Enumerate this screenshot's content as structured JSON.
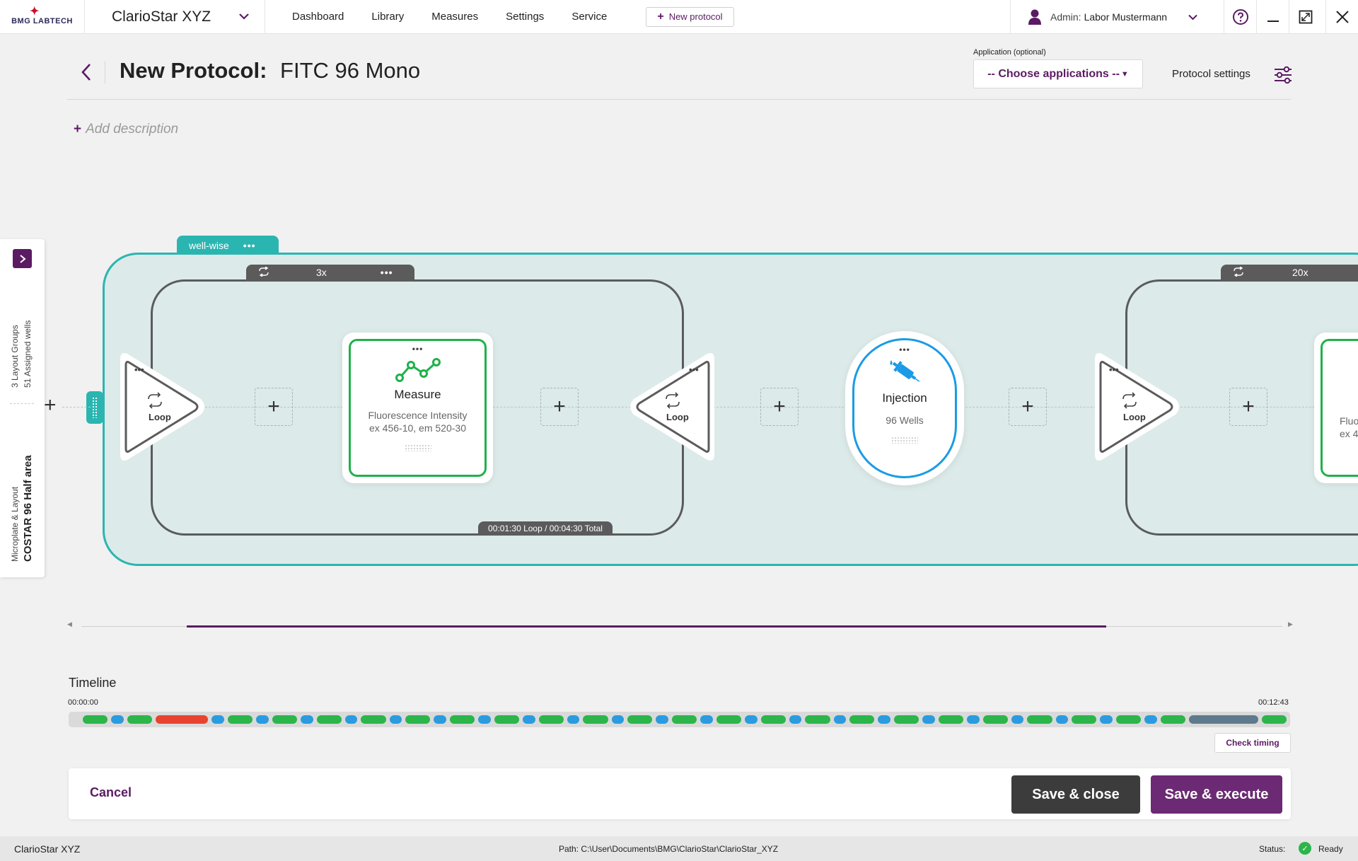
{
  "app": {
    "logo": "BMG LABTECH",
    "device_name": "ClarioStar XYZ"
  },
  "nav": {
    "items": [
      "Dashboard",
      "Library",
      "Measures",
      "Settings",
      "Service"
    ],
    "new_protocol": "New protocol"
  },
  "user": {
    "role": "Admin:",
    "name": "Labor Mustermann"
  },
  "header": {
    "title_prefix": "New Protocol:",
    "title_name": "FITC 96 Mono",
    "application_label": "Application (optional)",
    "application_value": "-- Choose applications --",
    "protocol_settings": "Protocol settings",
    "add_description": "Add description"
  },
  "side_panel": {
    "layout_groups": "3 Layout Groups",
    "assigned_wells": "51 Assigned wells",
    "microplate_label": "Microplate & Layout",
    "microplate_value": "COSTAR 96 Half area"
  },
  "canvas": {
    "well_group_label": "well-wise",
    "loop1": {
      "count": "3x",
      "timing": "00:01:30 Loop / 00:04:30 Total"
    },
    "loop2": {
      "count": "20x"
    },
    "loop_label": "Loop",
    "measure": {
      "title": "Measure",
      "line1": "Fluorescence Intensity",
      "line2": "ex 456-10, em 520-30"
    },
    "injection": {
      "title": "Injection",
      "sub": "96 Wells"
    },
    "partial_node": {
      "line1": "Fluo",
      "line2": "ex 4"
    }
  },
  "timeline": {
    "title": "Timeline",
    "start": "00:00:00",
    "end": "00:12:43",
    "check_timing": "Check timing",
    "colors": {
      "measure": "#2bb54a",
      "injection": "#2b9be0",
      "error": "#e8432f",
      "idle": "#5e7b8c"
    },
    "segments": [
      {
        "t": "measure",
        "w": 36
      },
      {
        "t": "injection",
        "w": 18
      },
      {
        "t": "measure",
        "w": 36
      },
      {
        "t": "error",
        "w": 76
      },
      {
        "t": "injection",
        "w": 18
      },
      {
        "t": "measure",
        "w": 36
      },
      {
        "t": "injection",
        "w": 18
      },
      {
        "t": "measure",
        "w": 36
      },
      {
        "t": "injection",
        "w": 18
      },
      {
        "t": "measure",
        "w": 36
      },
      {
        "t": "injection",
        "w": 18
      },
      {
        "t": "measure",
        "w": 36
      },
      {
        "t": "injection",
        "w": 18
      },
      {
        "t": "measure",
        "w": 36
      },
      {
        "t": "injection",
        "w": 18
      },
      {
        "t": "measure",
        "w": 36
      },
      {
        "t": "injection",
        "w": 18
      },
      {
        "t": "measure",
        "w": 36
      },
      {
        "t": "injection",
        "w": 18
      },
      {
        "t": "measure",
        "w": 36
      },
      {
        "t": "injection",
        "w": 18
      },
      {
        "t": "measure",
        "w": 36
      },
      {
        "t": "injection",
        "w": 18
      },
      {
        "t": "measure",
        "w": 36
      },
      {
        "t": "injection",
        "w": 18
      },
      {
        "t": "measure",
        "w": 36
      },
      {
        "t": "injection",
        "w": 18
      },
      {
        "t": "measure",
        "w": 36
      },
      {
        "t": "injection",
        "w": 18
      },
      {
        "t": "measure",
        "w": 36
      },
      {
        "t": "injection",
        "w": 18
      },
      {
        "t": "measure",
        "w": 36
      },
      {
        "t": "injection",
        "w": 18
      },
      {
        "t": "measure",
        "w": 36
      },
      {
        "t": "injection",
        "w": 18
      },
      {
        "t": "measure",
        "w": 36
      },
      {
        "t": "injection",
        "w": 18
      },
      {
        "t": "measure",
        "w": 36
      },
      {
        "t": "injection",
        "w": 18
      },
      {
        "t": "measure",
        "w": 36
      },
      {
        "t": "injection",
        "w": 18
      },
      {
        "t": "measure",
        "w": 36
      },
      {
        "t": "injection",
        "w": 18
      },
      {
        "t": "measure",
        "w": 36
      },
      {
        "t": "injection",
        "w": 18
      },
      {
        "t": "measure",
        "w": 36
      },
      {
        "t": "injection",
        "w": 18
      },
      {
        "t": "measure",
        "w": 36
      },
      {
        "t": "idle",
        "w": 100
      },
      {
        "t": "measure",
        "w": 36
      }
    ]
  },
  "footer": {
    "cancel": "Cancel",
    "save_close": "Save & close",
    "save_execute": "Save & execute"
  },
  "statusbar": {
    "app": "ClarioStar XYZ",
    "path": "Path: C:\\User\\Documents\\BMG\\ClarioStar\\ClarioStar_XYZ",
    "status_label": "Status:",
    "status_value": "Ready"
  }
}
